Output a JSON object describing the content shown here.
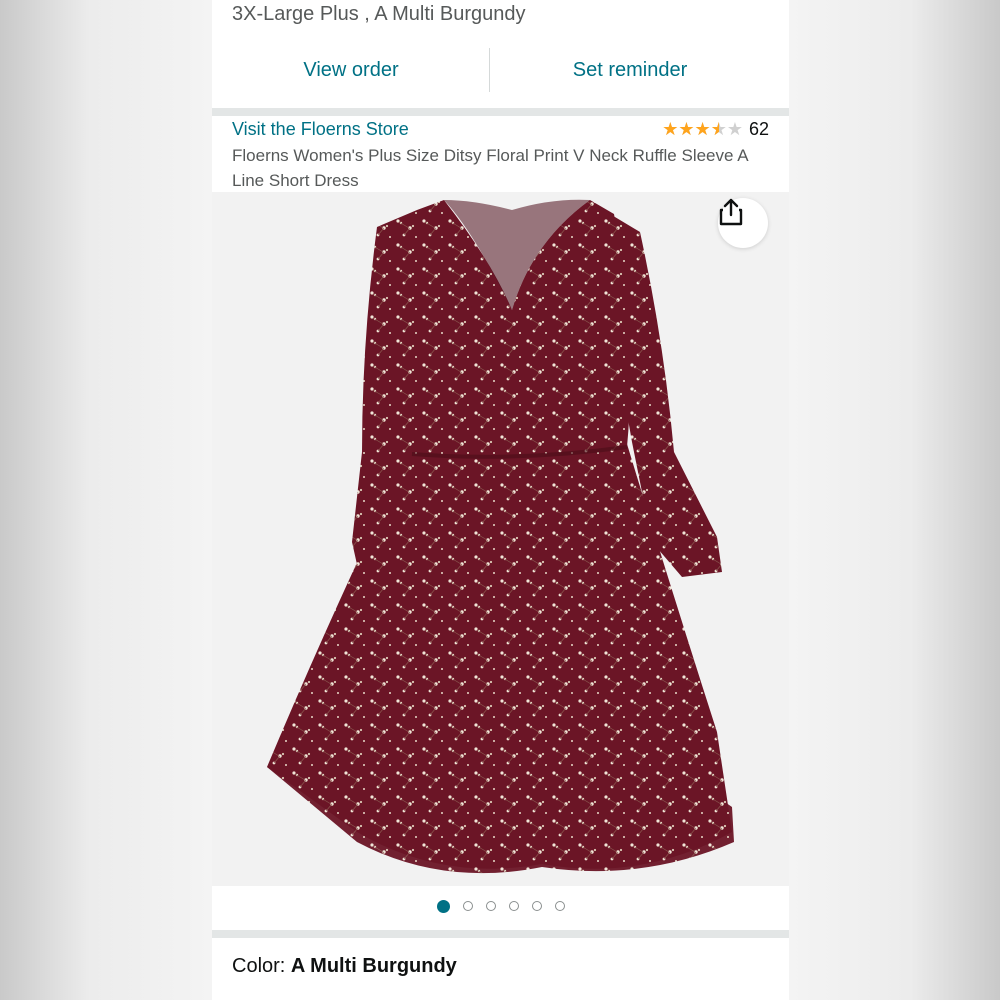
{
  "order": {
    "variant_line": "3X-Large Plus , A Multi Burgundy",
    "view_order_label": "View order",
    "set_reminder_label": "Set reminder"
  },
  "product": {
    "store_link": "Visit the Floerns Store",
    "rating_stars": 3.5,
    "rating_count": "62",
    "title": "Floerns Women's Plus Size Ditsy Floral Print V Neck Ruffle Sleeve A Line Short Dress",
    "image_count": 6,
    "active_image_index": 0,
    "share_icon": "share-icon"
  },
  "variation": {
    "color_label": "Color: ",
    "color_value": "A Multi Burgundy"
  },
  "colors": {
    "link": "#007185",
    "star": "#ffa41c",
    "dress": "#6b1526"
  }
}
